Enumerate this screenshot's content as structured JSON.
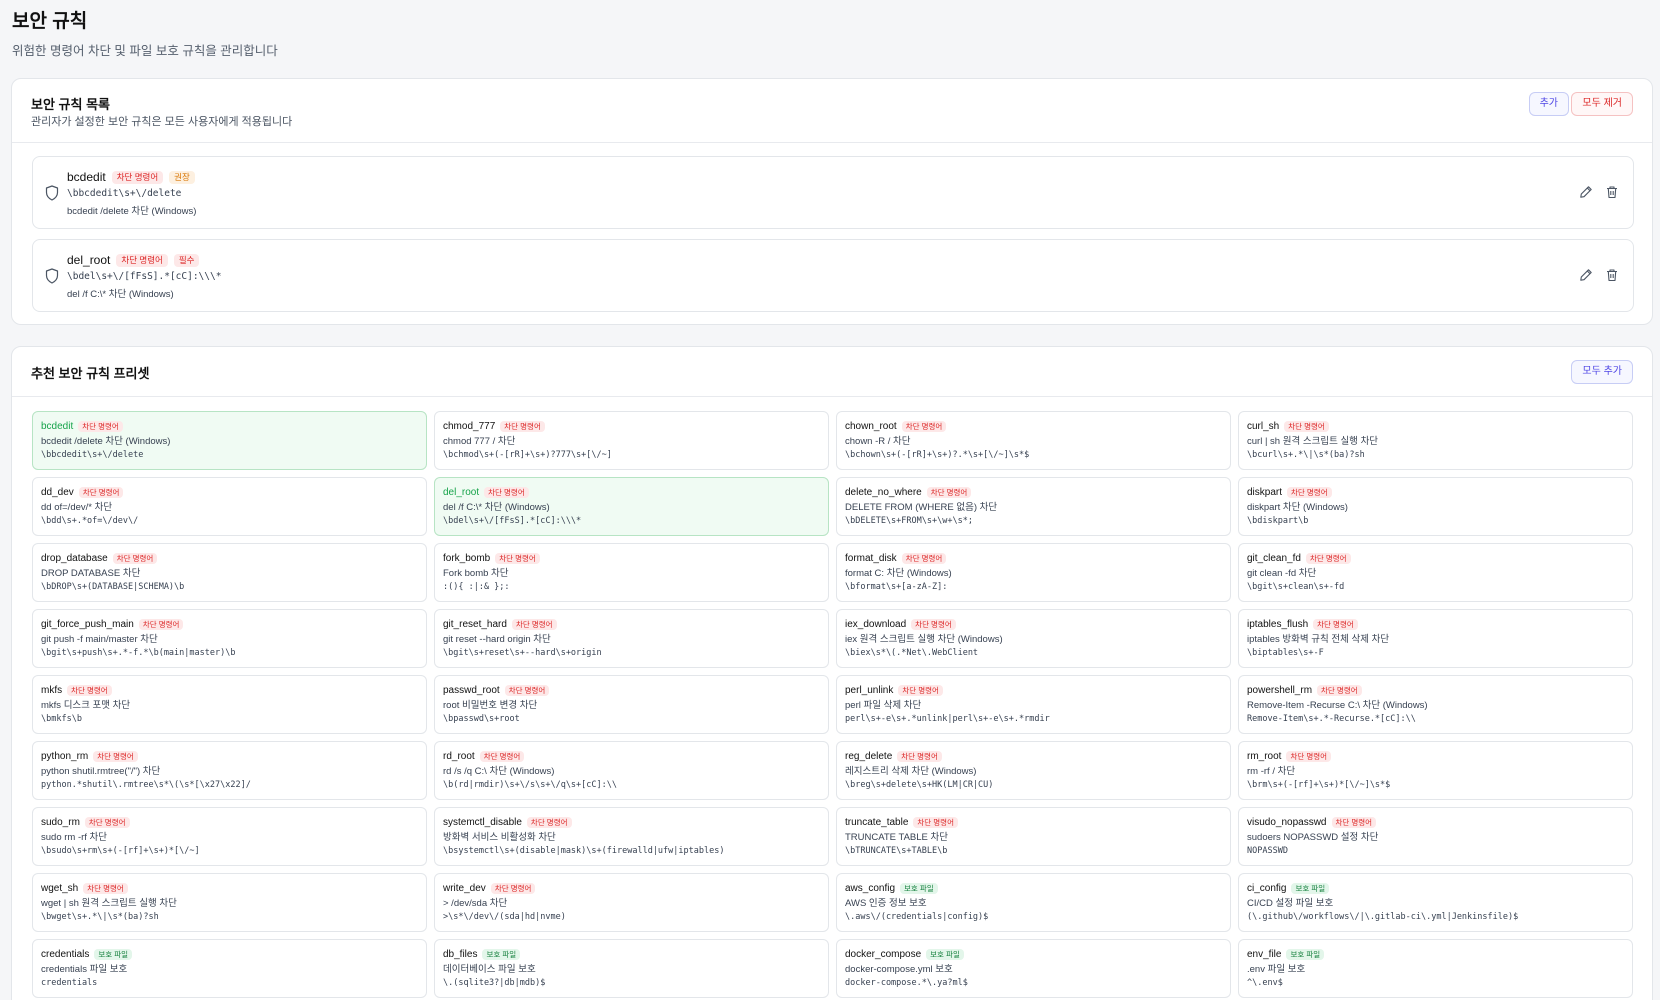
{
  "header": {
    "title": "보안 규칙",
    "subtitle": "위험한 명령어 차단 및 파일 보호 규칙을 관리합니다"
  },
  "rules_card": {
    "title": "보안 규칙 목록",
    "description": "관리자가 설정한 보안 규칙은 모든 사용자에게 적용됩니다",
    "add_label": "추가",
    "remove_all_label": "모두 제거",
    "rules": [
      {
        "name": "bcdedit",
        "type_badge": "차단 명령어",
        "level_badge": "권장",
        "pattern": "\\bbcdedit\\s+\\/delete",
        "description": "bcdedit /delete 차단 (Windows)"
      },
      {
        "name": "del_root",
        "type_badge": "차단 명령어",
        "level_badge": "필수",
        "pattern": "\\bdel\\s+\\/[fFsS].*[cC]:\\\\\\*",
        "description": "del /f C:\\* 차단 (Windows)"
      }
    ]
  },
  "presets_card": {
    "title": "추천 보안 규칙 프리셋",
    "add_all_label": "모두 추가",
    "presets": [
      {
        "name": "bcdedit",
        "badge": "차단 명령어",
        "kind": "block",
        "added": true,
        "description": "bcdedit /delete 차단 (Windows)",
        "pattern": "\\bbcdedit\\s+\\/delete"
      },
      {
        "name": "chmod_777",
        "badge": "차단 명령어",
        "kind": "block",
        "added": false,
        "description": "chmod 777 / 차단",
        "pattern": "\\bchmod\\s+(-[rR]+\\s+)?777\\s+[\\/~]"
      },
      {
        "name": "chown_root",
        "badge": "차단 명령어",
        "kind": "block",
        "added": false,
        "description": "chown -R / 차단",
        "pattern": "\\bchown\\s+(-[rR]+\\s+)?.*\\s+[\\/~]\\s*$"
      },
      {
        "name": "curl_sh",
        "badge": "차단 명령어",
        "kind": "block",
        "added": false,
        "description": "curl | sh 원격 스크립트 실행 차단",
        "pattern": "\\bcurl\\s+.*\\|\\s*(ba)?sh"
      },
      {
        "name": "dd_dev",
        "badge": "차단 명령어",
        "kind": "block",
        "added": false,
        "description": "dd of=/dev/* 차단",
        "pattern": "\\bdd\\s+.*of=\\/dev\\/"
      },
      {
        "name": "del_root",
        "badge": "차단 명령어",
        "kind": "block",
        "added": true,
        "description": "del /f C:\\* 차단 (Windows)",
        "pattern": "\\bdel\\s+\\/[fFsS].*[cC]:\\\\\\*"
      },
      {
        "name": "delete_no_where",
        "badge": "차단 명령어",
        "kind": "block",
        "added": false,
        "description": "DELETE FROM (WHERE 없음) 차단",
        "pattern": "\\bDELETE\\s+FROM\\s+\\w+\\s*;"
      },
      {
        "name": "diskpart",
        "badge": "차단 명령어",
        "kind": "block",
        "added": false,
        "description": "diskpart 차단 (Windows)",
        "pattern": "\\bdiskpart\\b"
      },
      {
        "name": "drop_database",
        "badge": "차단 명령어",
        "kind": "block",
        "added": false,
        "description": "DROP DATABASE 차단",
        "pattern": "\\bDROP\\s+(DATABASE|SCHEMA)\\b"
      },
      {
        "name": "fork_bomb",
        "badge": "차단 명령어",
        "kind": "block",
        "added": false,
        "description": "Fork bomb 차단",
        "pattern": ":(){ :|:& };:"
      },
      {
        "name": "format_disk",
        "badge": "차단 명령어",
        "kind": "block",
        "added": false,
        "description": "format C: 차단 (Windows)",
        "pattern": "\\bformat\\s+[a-zA-Z]:"
      },
      {
        "name": "git_clean_fd",
        "badge": "차단 명령어",
        "kind": "block",
        "added": false,
        "description": "git clean -fd 차단",
        "pattern": "\\bgit\\s+clean\\s+-fd"
      },
      {
        "name": "git_force_push_main",
        "badge": "차단 명령어",
        "kind": "block",
        "added": false,
        "description": "git push -f main/master 차단",
        "pattern": "\\bgit\\s+push\\s+.*-f.*\\b(main|master)\\b"
      },
      {
        "name": "git_reset_hard",
        "badge": "차단 명령어",
        "kind": "block",
        "added": false,
        "description": "git reset --hard origin 차단",
        "pattern": "\\bgit\\s+reset\\s+--hard\\s+origin"
      },
      {
        "name": "iex_download",
        "badge": "차단 명령어",
        "kind": "block",
        "added": false,
        "description": "iex 원격 스크립트 실행 차단 (Windows)",
        "pattern": "\\biex\\s*\\(.*Net\\.WebClient"
      },
      {
        "name": "iptables_flush",
        "badge": "차단 명령어",
        "kind": "block",
        "added": false,
        "description": "iptables 방화벽 규칙 전체 삭제 차단",
        "pattern": "\\biptables\\s+-F"
      },
      {
        "name": "mkfs",
        "badge": "차단 명령어",
        "kind": "block",
        "added": false,
        "description": "mkfs 디스크 포맷 차단",
        "pattern": "\\bmkfs\\b"
      },
      {
        "name": "passwd_root",
        "badge": "차단 명령어",
        "kind": "block",
        "added": false,
        "description": "root 비밀번호 변경 차단",
        "pattern": "\\bpasswd\\s+root"
      },
      {
        "name": "perl_unlink",
        "badge": "차단 명령어",
        "kind": "block",
        "added": false,
        "description": "perl 파일 삭제 차단",
        "pattern": "perl\\s+-e\\s+.*unlink|perl\\s+-e\\s+.*rmdir"
      },
      {
        "name": "powershell_rm",
        "badge": "차단 명령어",
        "kind": "block",
        "added": false,
        "description": "Remove-Item -Recurse C:\\ 차단 (Windows)",
        "pattern": "Remove-Item\\s+.*-Recurse.*[cC]:\\\\"
      },
      {
        "name": "python_rm",
        "badge": "차단 명령어",
        "kind": "block",
        "added": false,
        "description": "python shutil.rmtree(\"/\") 차단",
        "pattern": "python.*shutil\\.rmtree\\s*\\(\\s*[\\x27\\x22]/"
      },
      {
        "name": "rd_root",
        "badge": "차단 명령어",
        "kind": "block",
        "added": false,
        "description": "rd /s /q C:\\ 차단 (Windows)",
        "pattern": "\\b(rd|rmdir)\\s+\\/s\\s+\\/q\\s+[cC]:\\\\"
      },
      {
        "name": "reg_delete",
        "badge": "차단 명령어",
        "kind": "block",
        "added": false,
        "description": "레지스트리 삭제 차단 (Windows)",
        "pattern": "\\breg\\s+delete\\s+HK(LM|CR|CU)"
      },
      {
        "name": "rm_root",
        "badge": "차단 명령어",
        "kind": "block",
        "added": false,
        "description": "rm -rf / 차단",
        "pattern": "\\brm\\s+(-[rf]+\\s+)*[\\/~]\\s*$"
      },
      {
        "name": "sudo_rm",
        "badge": "차단 명령어",
        "kind": "block",
        "added": false,
        "description": "sudo rm -rf 차단",
        "pattern": "\\bsudo\\s+rm\\s+(-[rf]+\\s+)*[\\/~]"
      },
      {
        "name": "systemctl_disable",
        "badge": "차단 명령어",
        "kind": "block",
        "added": false,
        "description": "방화벽 서비스 비활성화 차단",
        "pattern": "\\bsystemctl\\s+(disable|mask)\\s+(firewalld|ufw|iptables)"
      },
      {
        "name": "truncate_table",
        "badge": "차단 명령어",
        "kind": "block",
        "added": false,
        "description": "TRUNCATE TABLE 차단",
        "pattern": "\\bTRUNCATE\\s+TABLE\\b"
      },
      {
        "name": "visudo_nopasswd",
        "badge": "차단 명령어",
        "kind": "block",
        "added": false,
        "description": "sudoers NOPASSWD 설정 차단",
        "pattern": "NOPASSWD"
      },
      {
        "name": "wget_sh",
        "badge": "차단 명령어",
        "kind": "block",
        "added": false,
        "description": "wget | sh 원격 스크립트 실행 차단",
        "pattern": "\\bwget\\s+.*\\|\\s*(ba)?sh"
      },
      {
        "name": "write_dev",
        "badge": "차단 명령어",
        "kind": "block",
        "added": false,
        "description": "> /dev/sda 차단",
        "pattern": ">\\s*\\/dev\\/(sda|hd|nvme)"
      },
      {
        "name": "aws_config",
        "badge": "보호 파일",
        "kind": "protect",
        "added": false,
        "description": "AWS 인증 정보 보호",
        "pattern": "\\.aws\\/(credentials|config)$"
      },
      {
        "name": "ci_config",
        "badge": "보호 파일",
        "kind": "protect",
        "added": false,
        "description": "CI/CD 설정 파일 보호",
        "pattern": "(\\.github\\/workflows\\/|\\.gitlab-ci\\.yml|Jenkinsfile)$"
      },
      {
        "name": "credentials",
        "badge": "보호 파일",
        "kind": "protect",
        "added": false,
        "description": "credentials 파일 보호",
        "pattern": "credentials"
      },
      {
        "name": "db_files",
        "badge": "보호 파일",
        "kind": "protect",
        "added": false,
        "description": "데이터베이스 파일 보호",
        "pattern": "\\.(sqlite3?|db|mdb)$"
      },
      {
        "name": "docker_compose",
        "badge": "보호 파일",
        "kind": "protect",
        "added": false,
        "description": "docker-compose.yml 보호",
        "pattern": "docker-compose.*\\.ya?ml$"
      },
      {
        "name": "env_file",
        "badge": "보호 파일",
        "kind": "protect",
        "added": false,
        "description": ".env 파일 보호",
        "pattern": "^\\.env$"
      }
    ]
  }
}
